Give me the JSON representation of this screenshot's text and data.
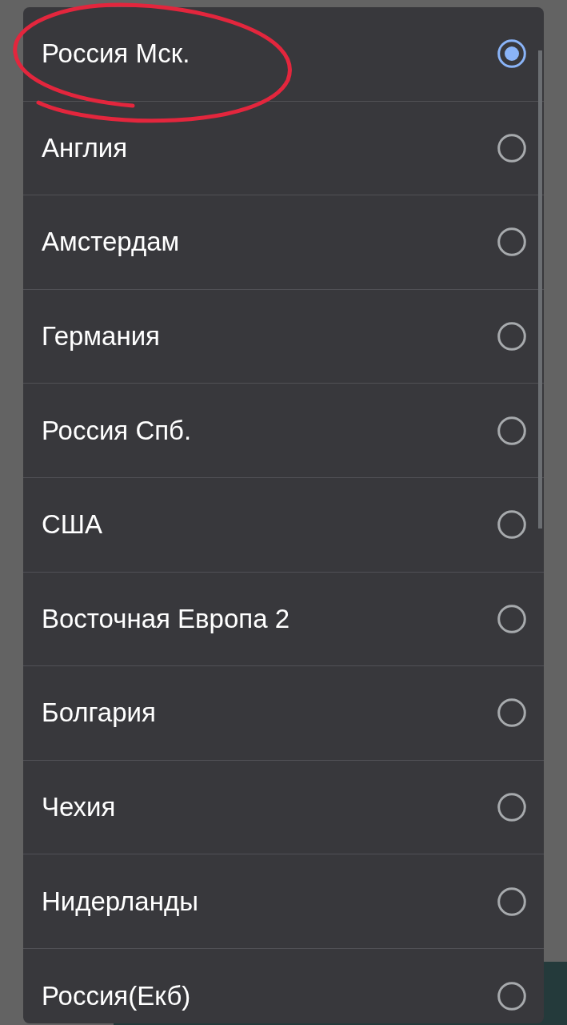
{
  "dialog": {
    "options": [
      {
        "label": "Россия Мск.",
        "selected": true
      },
      {
        "label": "Англия",
        "selected": false
      },
      {
        "label": "Амстердам",
        "selected": false
      },
      {
        "label": "Германия",
        "selected": false
      },
      {
        "label": "Россия Спб.",
        "selected": false
      },
      {
        "label": "США",
        "selected": false
      },
      {
        "label": "Восточная Европа 2",
        "selected": false
      },
      {
        "label": "Болгария",
        "selected": false
      },
      {
        "label": "Чехия",
        "selected": false
      },
      {
        "label": "Нидерланды",
        "selected": false
      },
      {
        "label": "Россия(Екб)",
        "selected": false
      }
    ]
  }
}
